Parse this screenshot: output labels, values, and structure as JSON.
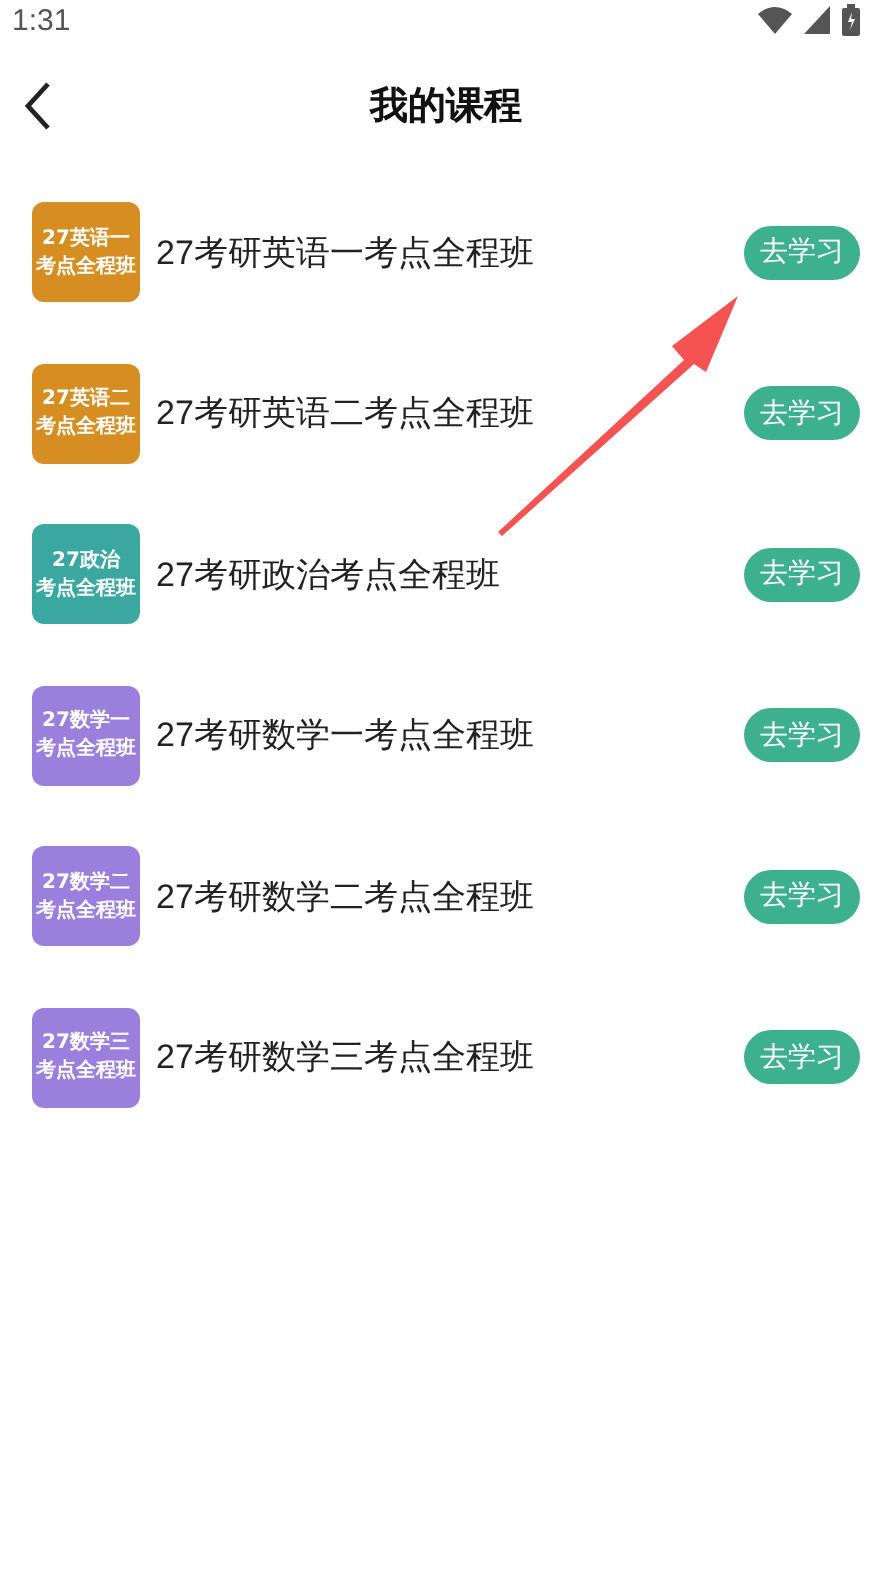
{
  "status_bar": {
    "time": "1:31"
  },
  "header": {
    "title": "我的课程"
  },
  "courses": [
    {
      "cover_lines": [
        "27英语一",
        "考点全程班"
      ],
      "color": "#d68e22",
      "title": "27考研英语一考点全程班",
      "action": "去学习"
    },
    {
      "cover_lines": [
        "27英语二",
        "考点全程班"
      ],
      "color": "#d68e22",
      "title": "27考研英语二考点全程班",
      "action": "去学习"
    },
    {
      "cover_lines": [
        "27政治",
        "考点全程班"
      ],
      "color": "#3aa8a0",
      "title": "27考研政治考点全程班",
      "action": "去学习"
    },
    {
      "cover_lines": [
        "27数学一",
        "考点全程班"
      ],
      "color": "#9b7fdc",
      "title": "27考研数学一考点全程班",
      "action": "去学习"
    },
    {
      "cover_lines": [
        "27数学二",
        "考点全程班"
      ],
      "color": "#9b7fdc",
      "title": "27考研数学二考点全程班",
      "action": "去学习"
    },
    {
      "cover_lines": [
        "27数学三",
        "考点全程班"
      ],
      "color": "#9b7fdc",
      "title": "27考研数学三考点全程班",
      "action": "去学习"
    }
  ]
}
